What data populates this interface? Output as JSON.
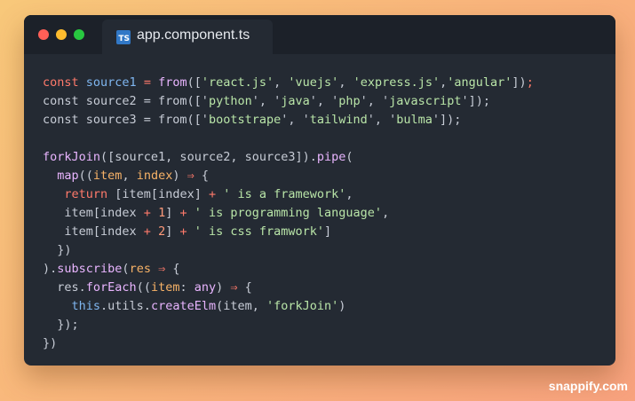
{
  "window": {
    "tab": {
      "icon": "typescript-file-icon",
      "badge": "TS",
      "label": "app.component.ts"
    }
  },
  "colors": {
    "background_gradient": [
      "#f8c87a",
      "#f8a27e"
    ],
    "editor_bg": "#242a33",
    "keyword": "#ff7a6b",
    "variable": "#7fb6f0",
    "function": "#e9b5ff",
    "string": "#b9e5a8",
    "parameter": "#f7b267",
    "plain": "#c7ccd6"
  },
  "code": {
    "lines": [
      [
        [
          "kw",
          "const "
        ],
        [
          "var",
          "source1 "
        ],
        [
          "op",
          "= "
        ],
        [
          "fn",
          "from"
        ],
        [
          "punc",
          "(["
        ],
        [
          "str",
          "'react.js'"
        ],
        [
          "punc",
          ", "
        ],
        [
          "str",
          "'vuejs'"
        ],
        [
          "punc",
          ", "
        ],
        [
          "str",
          "'express.js'"
        ],
        [
          "punc",
          ","
        ],
        [
          "str",
          "'angular'"
        ],
        [
          "punc",
          "])"
        ],
        [
          "op",
          ";"
        ]
      ],
      [
        [
          "plain",
          "const source2 = from(['"
        ],
        [
          "str",
          "python"
        ],
        [
          "plain",
          "', '"
        ],
        [
          "str",
          "java"
        ],
        [
          "plain",
          "', '"
        ],
        [
          "str",
          "php"
        ],
        [
          "plain",
          "', '"
        ],
        [
          "str",
          "javascript"
        ],
        [
          "plain",
          "']);"
        ]
      ],
      [
        [
          "plain",
          "const source3 = from(['"
        ],
        [
          "str",
          "bootstrape"
        ],
        [
          "plain",
          "', '"
        ],
        [
          "str",
          "tailwind"
        ],
        [
          "plain",
          "', '"
        ],
        [
          "str",
          "bulma"
        ],
        [
          "plain",
          "']);"
        ]
      ],
      [],
      [
        [
          "fn",
          "forkJoin"
        ],
        [
          "punc",
          "([source1, source2, source3])."
        ],
        [
          "fn",
          "pipe"
        ],
        [
          "punc",
          "("
        ]
      ],
      [
        [
          "plain",
          "  "
        ],
        [
          "fn",
          "map"
        ],
        [
          "punc",
          "(("
        ],
        [
          "param",
          "item"
        ],
        [
          "punc",
          ", "
        ],
        [
          "param",
          "index"
        ],
        [
          "punc",
          ") "
        ],
        [
          "op",
          "⇒ "
        ],
        [
          "punc",
          "{"
        ]
      ],
      [
        [
          "plain",
          "   "
        ],
        [
          "kw",
          "return "
        ],
        [
          "punc",
          "[item[index] "
        ],
        [
          "op",
          "+ "
        ],
        [
          "str",
          "' is a framework'"
        ],
        [
          "punc",
          ","
        ]
      ],
      [
        [
          "plain",
          "   item[index "
        ],
        [
          "op",
          "+ "
        ],
        [
          "num",
          "1"
        ],
        [
          "plain",
          "] "
        ],
        [
          "op",
          "+ "
        ],
        [
          "str",
          "' is programming language'"
        ],
        [
          "punc",
          ","
        ]
      ],
      [
        [
          "plain",
          "   item[index "
        ],
        [
          "op",
          "+ "
        ],
        [
          "num",
          "2"
        ],
        [
          "plain",
          "] "
        ],
        [
          "op",
          "+ "
        ],
        [
          "str",
          "' is css framwork'"
        ],
        [
          "punc",
          "]"
        ]
      ],
      [
        [
          "punc",
          "  })"
        ]
      ],
      [
        [
          "punc",
          ")."
        ],
        [
          "fn",
          "subscribe"
        ],
        [
          "punc",
          "("
        ],
        [
          "param",
          "res "
        ],
        [
          "op",
          "⇒ "
        ],
        [
          "punc",
          "{"
        ]
      ],
      [
        [
          "plain",
          "  res."
        ],
        [
          "fn",
          "forEach"
        ],
        [
          "punc",
          "(("
        ],
        [
          "param",
          "item"
        ],
        [
          "punc",
          ": "
        ],
        [
          "type",
          "any"
        ],
        [
          "punc",
          ") "
        ],
        [
          "op",
          "⇒ "
        ],
        [
          "punc",
          "{"
        ]
      ],
      [
        [
          "plain",
          "    "
        ],
        [
          "var",
          "this"
        ],
        [
          "plain",
          ".utils."
        ],
        [
          "fn",
          "createElm"
        ],
        [
          "punc",
          "(item, "
        ],
        [
          "str",
          "'forkJoin'"
        ],
        [
          "punc",
          ")"
        ]
      ],
      [
        [
          "punc",
          "  });"
        ]
      ],
      [
        [
          "punc",
          "})"
        ]
      ]
    ]
  },
  "watermark": "snappify.com"
}
